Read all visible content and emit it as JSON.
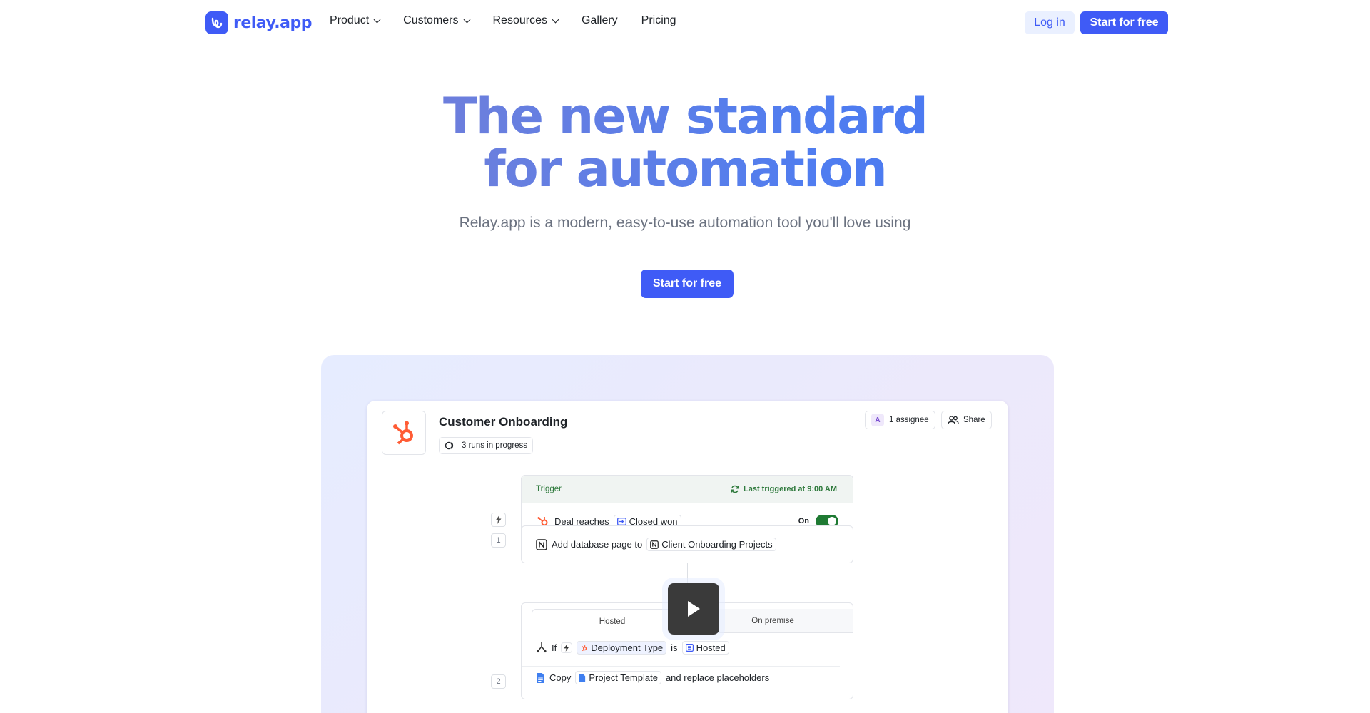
{
  "nav": {
    "logo_text": "relay.app",
    "links": [
      {
        "label": "Product",
        "dropdown": true
      },
      {
        "label": "Customers",
        "dropdown": true
      },
      {
        "label": "Resources",
        "dropdown": true
      },
      {
        "label": "Gallery",
        "dropdown": false
      },
      {
        "label": "Pricing",
        "dropdown": false
      }
    ],
    "login_label": "Log in",
    "start_label": "Start for free"
  },
  "hero": {
    "title_line1": "The new standard",
    "title_line2": "for automation",
    "subtitle": "Relay.app is a modern, easy-to-use automation tool you'll love using",
    "cta_label": "Start for free"
  },
  "workflow": {
    "title": "Customer Onboarding",
    "runs": "3 runs in progress",
    "assignee_initial": "A",
    "assignee_label": "1 assignee",
    "share_label": "Share",
    "trigger": {
      "header": "Trigger",
      "last_triggered": "Last triggered at 9:00 AM",
      "text": "Deal reaches",
      "chip": "Closed won",
      "toggle_label": "On",
      "toggle_on": true
    },
    "step1": {
      "num": "1",
      "text": "Add database page to",
      "chip": "Client Onboarding Projects"
    },
    "branch": {
      "tab_hosted": "Hosted",
      "tab_onprem": "On premise",
      "if_label": "If",
      "field_chip": "Deployment Type",
      "is_label": "is",
      "value_chip": "Hosted"
    },
    "step2": {
      "num": "2",
      "copy_label": "Copy",
      "chip": "Project Template",
      "suffix": "and replace placeholders"
    }
  },
  "colors": {
    "brand": "#3f5bf6",
    "hubspot": "#ff5c35",
    "trigger_green": "#2f7a3d"
  },
  "icons": {
    "play": "play-icon",
    "hubspot": "hubspot-icon",
    "notion": "notion-icon",
    "docs": "google-docs-icon"
  }
}
